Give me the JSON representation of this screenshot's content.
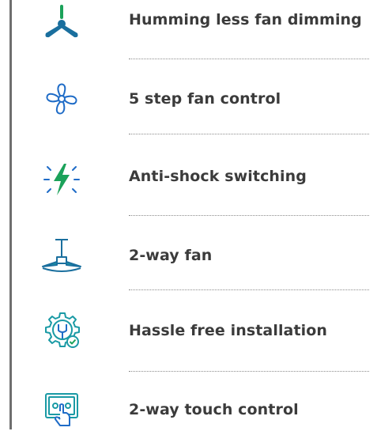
{
  "colors": {
    "teal": "#1a9aa5",
    "green": "#1ba25a",
    "blue": "#1f6cc7",
    "text": "#3b3b3b",
    "rule": "#6f6f6f",
    "dots": "#8c8c8c"
  },
  "features": [
    {
      "icon": "ceiling-fan-icon",
      "label": "Humming less fan dimming"
    },
    {
      "icon": "fan-blades-icon",
      "label": "5 step fan  control"
    },
    {
      "icon": "lightning-bolt-icon",
      "label": "Anti-shock switching"
    },
    {
      "icon": "fan-side-view-icon",
      "label": "2-way fan"
    },
    {
      "icon": "wrench-gear-icon",
      "label": "Hassle free installation"
    },
    {
      "icon": "touch-panel-icon",
      "label": "2-way touch control"
    }
  ]
}
